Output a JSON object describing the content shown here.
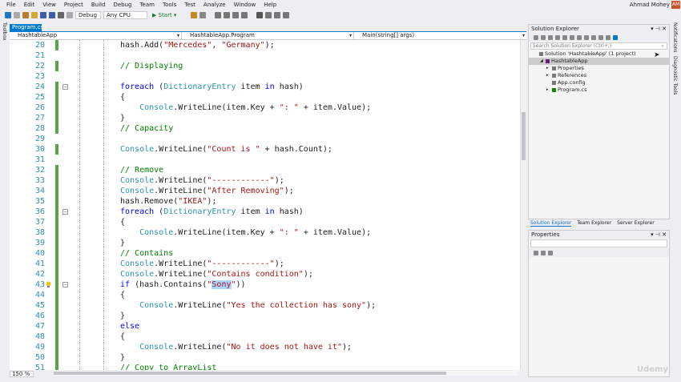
{
  "menu": [
    "File",
    "Edit",
    "View",
    "Project",
    "Build",
    "Debug",
    "Team",
    "Tools",
    "Test",
    "Analyze",
    "Window",
    "Help"
  ],
  "user": {
    "name": "Ahmad Mohey",
    "initials": "AM"
  },
  "toolbar": {
    "config": "Debug",
    "platform": "Any CPU",
    "start": "▶ Start ▾"
  },
  "left_strip": "Toolbox",
  "right_strip": [
    "Notifications",
    "Diagnostic Tools"
  ],
  "doc_tab": {
    "label": "Program.cs",
    "close": "✕"
  },
  "navbar": {
    "project": "HashtableApp",
    "class": "HashtableApp.Program",
    "member": "Main(string[] args)"
  },
  "code_lines": [
    {
      "n": "20",
      "c": "    hash.Add(\"Mercedes\", \"Germany\");"
    },
    {
      "n": "21",
      "c": ""
    },
    {
      "n": "22",
      "c": "    // Displaying"
    },
    {
      "n": "23",
      "c": ""
    },
    {
      "n": "24",
      "c": "    foreach (DictionaryEntry item in hash)"
    },
    {
      "n": "25",
      "c": "    {"
    },
    {
      "n": "26",
      "c": "        Console.WriteLine(item.Key + \": \" + item.Value);"
    },
    {
      "n": "27",
      "c": "    }"
    },
    {
      "n": "28",
      "c": "    // Capacity"
    },
    {
      "n": "29",
      "c": ""
    },
    {
      "n": "30",
      "c": "    Console.WriteLine(\"Count is \" + hash.Count);"
    },
    {
      "n": "31",
      "c": ""
    },
    {
      "n": "32",
      "c": "    // Remove"
    },
    {
      "n": "33",
      "c": "    Console.WriteLine(\"------------\");"
    },
    {
      "n": "34",
      "c": "    Console.WriteLine(\"After Removing\");"
    },
    {
      "n": "35",
      "c": "    hash.Remove(\"IKEA\");"
    },
    {
      "n": "36",
      "c": "    foreach (DictionaryEntry item in hash)"
    },
    {
      "n": "37",
      "c": "    {"
    },
    {
      "n": "38",
      "c": "        Console.WriteLine(item.Key + \": \" + item.Value);"
    },
    {
      "n": "39",
      "c": "    }"
    },
    {
      "n": "40",
      "c": "    // Contains"
    },
    {
      "n": "41",
      "c": "    Console.WriteLine(\"------------\");"
    },
    {
      "n": "42",
      "c": "    Console.WriteLine(\"Contains condition\");"
    },
    {
      "n": "43",
      "c": "    if (hash.Contains(\"Sony\"))"
    },
    {
      "n": "44",
      "c": "    {"
    },
    {
      "n": "45",
      "c": "        Console.WriteLine(\"Yes the collection has sony\");"
    },
    {
      "n": "46",
      "c": "    }"
    },
    {
      "n": "47",
      "c": "    else"
    },
    {
      "n": "48",
      "c": "    {"
    },
    {
      "n": "49",
      "c": "        Console.WriteLine(\"No it does not have it\");"
    },
    {
      "n": "50",
      "c": "    }"
    },
    {
      "n": "51",
      "c": "    // Copy to ArrayList"
    }
  ],
  "zoom": "150 %",
  "solution_explorer": {
    "title": "Solution Explorer",
    "search_placeholder": "Search Solution Explorer (Ctrl+;)",
    "items": [
      {
        "label": "Solution 'HashtableApp' (1 project)",
        "indent": 0
      },
      {
        "label": "HashtableApp",
        "indent": 1
      },
      {
        "label": "Properties",
        "indent": 2
      },
      {
        "label": "References",
        "indent": 2
      },
      {
        "label": "App.config",
        "indent": 2
      },
      {
        "label": "Program.cs",
        "indent": 2
      }
    ]
  },
  "panel_tabs": [
    "Solution Explorer",
    "Team Explorer",
    "Server Explorer"
  ],
  "properties": {
    "title": "Properties"
  },
  "watermark": "Udemy"
}
